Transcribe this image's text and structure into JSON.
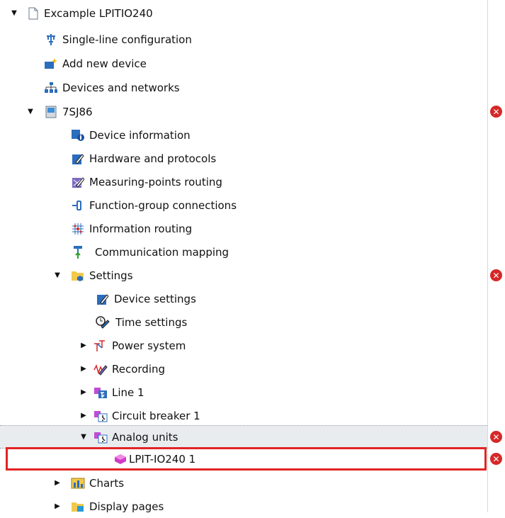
{
  "tree": {
    "project": "Excample LPITIO240",
    "single_line": "Single-line configuration",
    "add_device": "Add new device",
    "devices_networks": "Devices and networks",
    "device": "7SJ86",
    "device_info": "Device information",
    "hardware": "Hardware and protocols",
    "measuring": "Measuring-points routing",
    "function_group": "Function-group connections",
    "info_routing": "Information routing",
    "comm_mapping": "Communication mapping",
    "settings": "Settings",
    "device_settings": "Device settings",
    "time_settings": "Time settings",
    "power_system": "Power system",
    "recording": "Recording",
    "line1": "Line 1",
    "circuit_breaker": "Circuit breaker 1",
    "analog_units": "Analog units",
    "lpit": "LPIT-IO240 1",
    "charts": "Charts",
    "display_pages": "Display pages"
  },
  "status": {
    "error_glyph": "✕"
  },
  "colors": {
    "error": "#d62828",
    "highlight": "#e02424",
    "selected_row": "#e9ecef"
  }
}
